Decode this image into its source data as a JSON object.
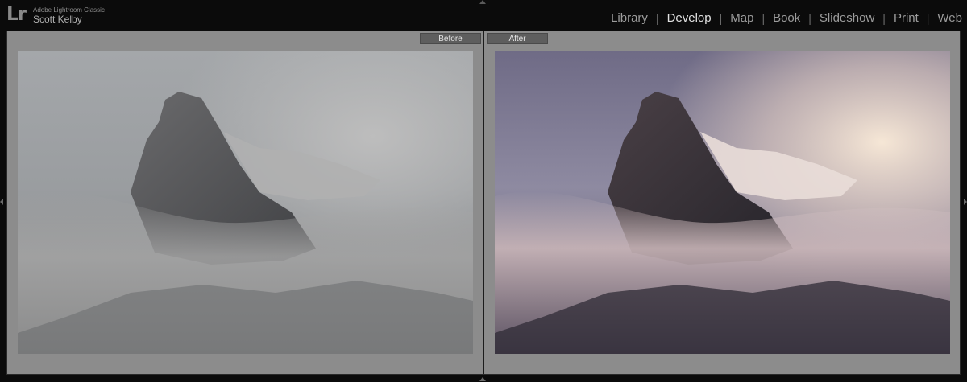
{
  "identity": {
    "logo": "Lr",
    "product": "Adobe Lightroom Classic",
    "user": "Scott Kelby"
  },
  "modules": [
    {
      "label": "Library",
      "active": false
    },
    {
      "label": "Develop",
      "active": true
    },
    {
      "label": "Map",
      "active": false
    },
    {
      "label": "Book",
      "active": false
    },
    {
      "label": "Slideshow",
      "active": false
    },
    {
      "label": "Print",
      "active": false
    },
    {
      "label": "Web",
      "active": false
    }
  ],
  "separator": "|",
  "compare": {
    "before_label": "Before",
    "after_label": "After"
  },
  "colors": {
    "background": "#0b0b0b",
    "workspace": "#8c8c8c",
    "tab": "#5e5e5e",
    "active_module": "#e2e2e2",
    "inactive_module": "#9c9c9c"
  },
  "icons": [
    "collapse-top-panel-icon",
    "collapse-bottom-panel-icon",
    "collapse-left-panel-icon",
    "collapse-right-panel-icon"
  ]
}
